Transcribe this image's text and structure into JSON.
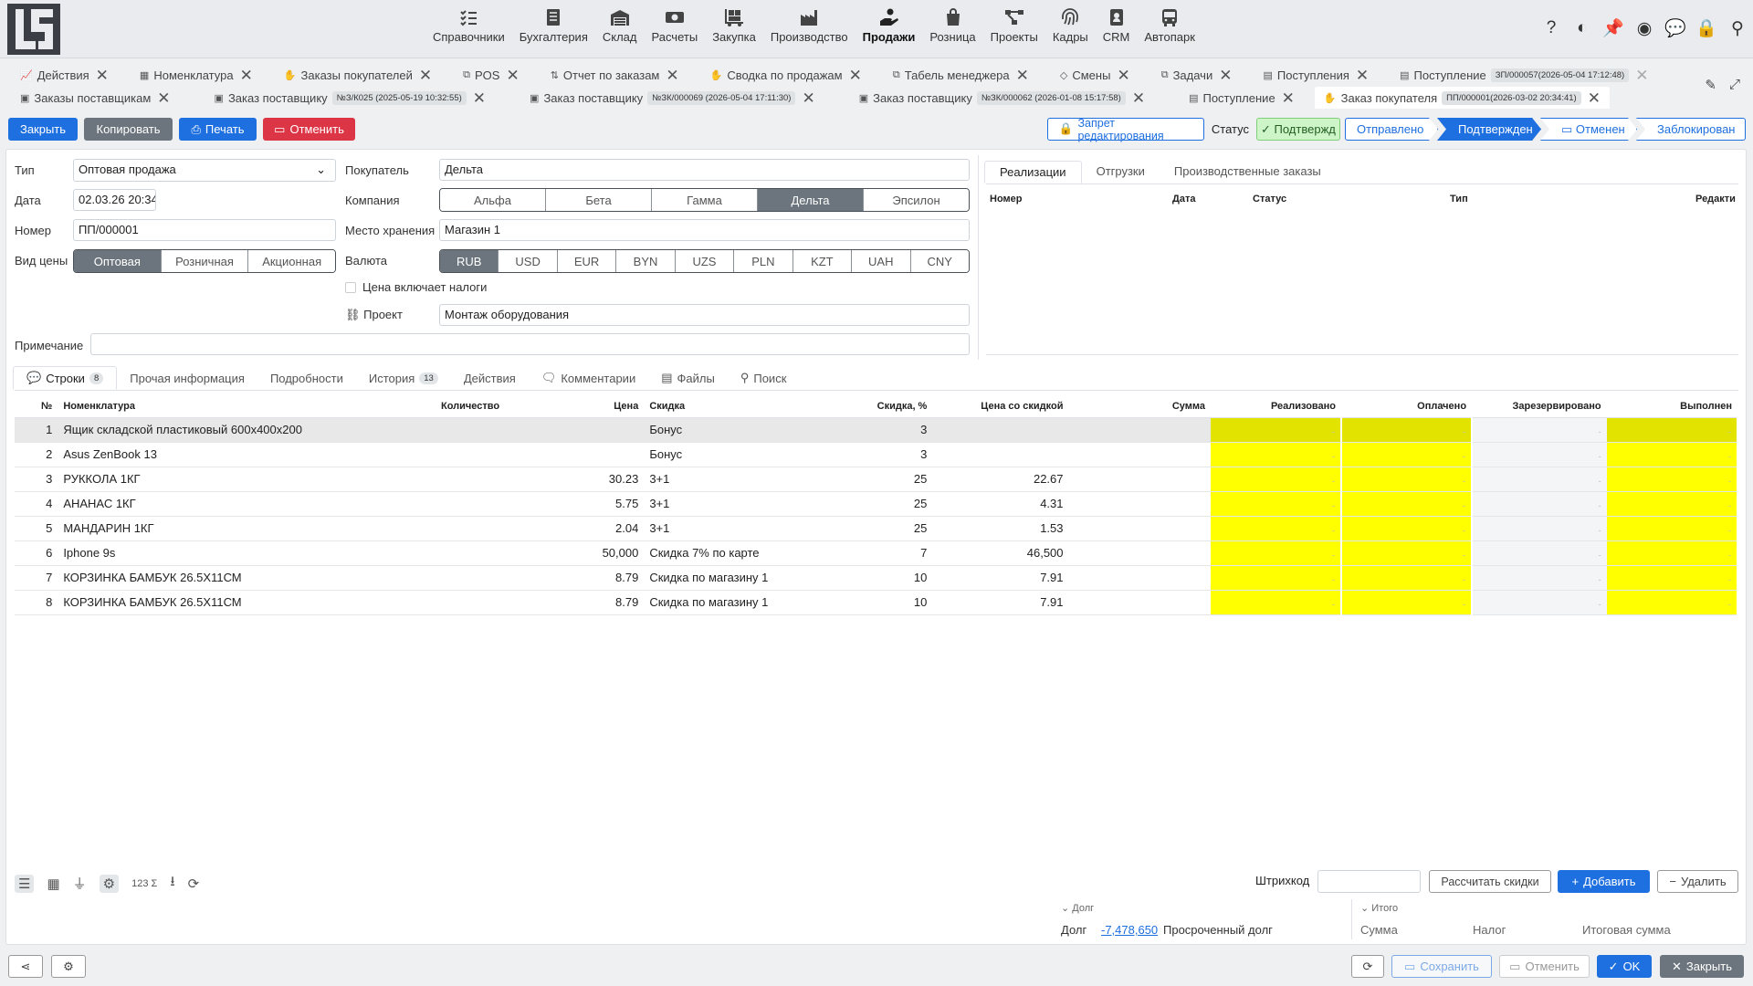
{
  "nav": {
    "items": [
      {
        "label": "Справочники",
        "icon": "list-check-icon"
      },
      {
        "label": "Бухгалтерия",
        "icon": "ledger-icon"
      },
      {
        "label": "Склад",
        "icon": "warehouse-icon"
      },
      {
        "label": "Расчеты",
        "icon": "cash-icon"
      },
      {
        "label": "Закупка",
        "icon": "dolly-icon"
      },
      {
        "label": "Производство",
        "icon": "factory-icon"
      },
      {
        "label": "Продажи",
        "icon": "hand-coin-icon"
      },
      {
        "label": "Розница",
        "icon": "shopping-bag-icon"
      },
      {
        "label": "Проекты",
        "icon": "project-diagram-icon"
      },
      {
        "label": "Кадры",
        "icon": "fingerprint-icon"
      },
      {
        "label": "CRM",
        "icon": "id-badge-icon"
      },
      {
        "label": "Автопарк",
        "icon": "bus-icon"
      }
    ],
    "active": "Продажи"
  },
  "tabs_row1": [
    {
      "label": "Действия"
    },
    {
      "label": "Номенклатура"
    },
    {
      "label": "Заказы покупателей"
    },
    {
      "label": "POS"
    },
    {
      "label": "Отчет по заказам"
    },
    {
      "label": "Сводка по продажам"
    },
    {
      "label": "Табель менеджера"
    },
    {
      "label": "Смены"
    },
    {
      "label": "Задачи"
    },
    {
      "label": "Поступления"
    },
    {
      "label": "Поступление",
      "badge": "ЗП/000057(2026-05-04 17:12:48)"
    }
  ],
  "tabs_row2": [
    {
      "label": "Заказы поставщикам"
    },
    {
      "label": "Заказ поставщику",
      "badge": "№З/К025 (2025-05-19 10:32:55)"
    },
    {
      "label": "Заказ поставщику",
      "badge": "№ЗК/000069 (2026-05-04 17:11:30)"
    },
    {
      "label": "Заказ поставщику",
      "badge": "№ЗК/000062 (2026-01-08 15:17:58)"
    },
    {
      "label": "Поступление"
    },
    {
      "label": "Заказ покупателя",
      "badge": "ПП/000001(2026-03-02 20:34:41)"
    }
  ],
  "toolbar": {
    "close": "Закрыть",
    "copy": "Копировать",
    "print": "Печать",
    "cancel": "Отменить"
  },
  "status": {
    "lock_label": "Запрет редактирования",
    "label": "Статус",
    "current": "Подтвержд",
    "steps": [
      "Отправлено",
      "Подтвержден",
      "Отменен",
      "Заблокирован"
    ],
    "active_step": "Подтвержден"
  },
  "form": {
    "type_label": "Тип",
    "type_value": "Оптовая продажа",
    "date_label": "Дата",
    "date_value": "02.03.26 20:34",
    "number_label": "Номер",
    "number_value": "ПП/000001",
    "price_kind_label": "Вид цены",
    "price_kinds": [
      "Оптовая",
      "Розничная",
      "Акционная"
    ],
    "price_kind_active": "Оптовая",
    "buyer_label": "Покупатель",
    "buyer_value": "Дельта",
    "company_label": "Компания",
    "companies": [
      "Альфа",
      "Бета",
      "Гамма",
      "Дельта",
      "Эпсилон"
    ],
    "company_active": "Дельта",
    "storage_label": "Место хранения",
    "storage_value": "Магазин 1",
    "currency_label": "Валюта",
    "currencies": [
      "RUB",
      "USD",
      "EUR",
      "BYN",
      "UZS",
      "PLN",
      "KZT",
      "UAH",
      "CNY"
    ],
    "currency_active": "RUB",
    "tax_label": "Цена включает налоги",
    "project_label": "Проект",
    "project_value": "Монтаж оборудования",
    "note_label": "Примечание",
    "note_value": ""
  },
  "right_tabs": {
    "tabs": [
      "Реализации",
      "Отгрузки",
      "Производственные заказы"
    ],
    "active": "Реализации",
    "columns": [
      "Номер",
      "Дата",
      "Статус",
      "Тип",
      "Редакти"
    ]
  },
  "bottom_tabs": [
    {
      "label": "Строки",
      "count": "8",
      "icon": "comment-icon"
    },
    {
      "label": "Прочая информация"
    },
    {
      "label": "Подробности"
    },
    {
      "label": "История",
      "count": "13"
    },
    {
      "label": "Действия"
    },
    {
      "label": "Комментарии",
      "icon": "comments-icon"
    },
    {
      "label": "Файлы",
      "icon": "file-icon"
    },
    {
      "label": "Поиск",
      "icon": "search-icon"
    }
  ],
  "grid": {
    "columns": [
      "№",
      "Номенклатура",
      "Количество",
      "Цена",
      "Скидка",
      "Скидка, %",
      "Цена со скидкой",
      "Сумма",
      "Реализовано",
      "Оплачено",
      "Зарезервировано",
      "Выполнен"
    ],
    "rows": [
      {
        "n": "1",
        "name": "Ящик складской пластиковый 600x400x200",
        "qty": "",
        "price": "",
        "disc": "Бонус",
        "pct": "3",
        "dprice": ""
      },
      {
        "n": "2",
        "name": "Asus ZenBook 13",
        "qty": "",
        "price": "",
        "disc": "Бонус",
        "pct": "3",
        "dprice": ""
      },
      {
        "n": "3",
        "name": "РУККОЛА 1КГ",
        "qty": "",
        "price": "30.23",
        "disc": "3+1",
        "pct": "25",
        "dprice": "22.67"
      },
      {
        "n": "4",
        "name": "АНАНАС 1КГ",
        "qty": "",
        "price": "5.75",
        "disc": "3+1",
        "pct": "25",
        "dprice": "4.31"
      },
      {
        "n": "5",
        "name": "МАНДАРИН 1КГ",
        "qty": "",
        "price": "2.04",
        "disc": "3+1",
        "pct": "25",
        "dprice": "1.53"
      },
      {
        "n": "6",
        "name": "Iphone 9s",
        "qty": "",
        "price": "50,000",
        "disc": "Скидка 7% по карте",
        "pct": "7",
        "dprice": "46,500"
      },
      {
        "n": "7",
        "name": "КОРЗИНКА БАМБУК 26.5Х11СМ",
        "qty": "",
        "price": "8.79",
        "disc": "Скидка по магазину 1",
        "pct": "10",
        "dprice": "7.91"
      },
      {
        "n": "8",
        "name": "КОРЗИНКА БАМБУК 26.5Х11СМ",
        "qty": "",
        "price": "8.79",
        "disc": "Скидка по магазину 1",
        "pct": "10",
        "dprice": "7.91"
      }
    ],
    "dash": "-"
  },
  "footer": {
    "barcode_label": "Штрихкод",
    "recalc": "Рассчитать скидки",
    "add": "Добавить",
    "delete": "Удалить",
    "debt_head": "Долг",
    "debt_label": "Долг",
    "debt_value": "-7,478,650",
    "overdue_label": "Просроченный долг",
    "total_head": "Итого",
    "sum_label": "Сумма",
    "tax_label": "Налог",
    "total_label": "Итоговая сумма"
  },
  "bottom": {
    "save": "Сохранить",
    "cancel": "Отменить",
    "ok": "OK",
    "close": "Закрыть"
  }
}
